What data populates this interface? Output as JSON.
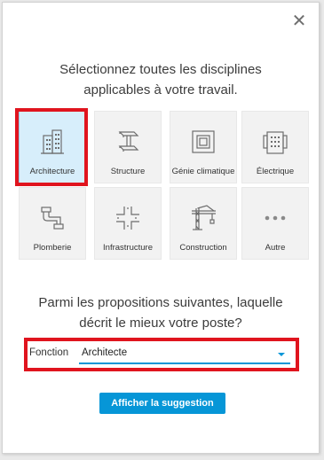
{
  "dialog": {
    "close_label": "✕",
    "question_disciplines": "Sélectionnez toutes les disciplines applicables à votre travail.",
    "disciplines": [
      {
        "label": "Architecture",
        "icon": "building-icon",
        "selected": true
      },
      {
        "label": "Structure",
        "icon": "steel-beam-icon",
        "selected": false
      },
      {
        "label": "Génie climatique",
        "icon": "hvac-vent-icon",
        "selected": false
      },
      {
        "label": "Électrique",
        "icon": "electrical-panel-icon",
        "selected": false
      },
      {
        "label": "Plomberie",
        "icon": "pipe-icon",
        "selected": false
      },
      {
        "label": "Infrastructure",
        "icon": "road-intersection-icon",
        "selected": false
      },
      {
        "label": "Construction",
        "icon": "crane-icon",
        "selected": false
      },
      {
        "label": "Autre",
        "icon": "more-dots-icon",
        "selected": false
      }
    ],
    "question_role": "Parmi les propositions suivantes, laquelle décrit le mieux votre poste?",
    "role_field": {
      "label": "Fonction",
      "value": "Architecte"
    },
    "submit_label": "Afficher la suggestion",
    "colors": {
      "accent": "#0696d7",
      "highlight": "#e0141e",
      "selected_tile": "#d7eefb"
    }
  }
}
